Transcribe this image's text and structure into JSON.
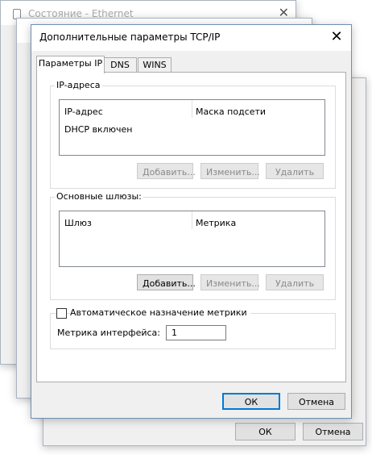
{
  "background_window": {
    "title": "Состояние - Ethernet",
    "ok_label": "ОК",
    "cancel_label": "Отмена"
  },
  "dialog": {
    "title": "Дополнительные параметры TCP/IP",
    "tabs": [
      {
        "label": "Параметры IP",
        "active": true
      },
      {
        "label": "DNS",
        "active": false
      },
      {
        "label": "WINS",
        "active": false
      }
    ],
    "ip_group": {
      "legend": "IP-адреса",
      "columns": [
        "IP-адрес",
        "Маска подсети"
      ],
      "rows": [
        "DHCP включен"
      ],
      "buttons": {
        "add": "Добавить...",
        "edit": "Изменить...",
        "remove": "Удалить"
      }
    },
    "gateway_group": {
      "legend": "Основные шлюзы:",
      "columns": [
        "Шлюз",
        "Метрика"
      ],
      "buttons": {
        "add": "Добавить...",
        "edit": "Изменить...",
        "remove": "Удалить"
      }
    },
    "metric_group": {
      "checkbox_label": "Автоматическое назначение метрики",
      "checked": false,
      "interface_metric_label": "Метрика интерфейса:",
      "interface_metric_value": "1"
    },
    "ok_label": "ОК",
    "cancel_label": "Отмена"
  }
}
